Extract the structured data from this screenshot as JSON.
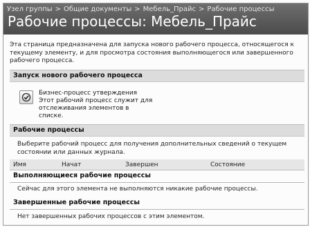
{
  "breadcrumb": {
    "items": [
      "Узел группы",
      "Общие документы",
      "Мебель_Прайс",
      "Рабочие процессы"
    ],
    "separator": ">"
  },
  "page_title": "Рабочие процессы: Мебель_Прайс",
  "intro_text": "Эта страница предназначена для запуска нового рабочего процесса, относящегося к текущему элементу, и для просмотра состояния выполняющегося или завершенного рабочего процесса.",
  "start_section": {
    "title": "Запуск нового рабочего процесса",
    "workflow": {
      "name": "Бизнес-процесс утверждения",
      "description": "Этот рабочий процесс служит для отслеживания элементов в списке.",
      "icon": "workflow-approval-icon"
    }
  },
  "workflows_section": {
    "title": "Рабочие процессы",
    "intro": "Выберите рабочий процесс для получения дополнительных сведений о текущем состоянии или данных журнала.",
    "columns": [
      "Имя",
      "Начат",
      "Завершен",
      "Состояние"
    ],
    "running": {
      "title": "Выполняющиеся рабочие процессы",
      "message": "Сейчас для этого элемента не выполняются никакие рабочие процессы."
    },
    "completed": {
      "title": "Завершенные рабочие процессы",
      "message": "Нет завершенных рабочих процессов с этим элементом."
    }
  },
  "colors": {
    "title_bar": "#5a5a5a",
    "section_bar": "#dcdcdc",
    "text": "#1c1c1c"
  }
}
